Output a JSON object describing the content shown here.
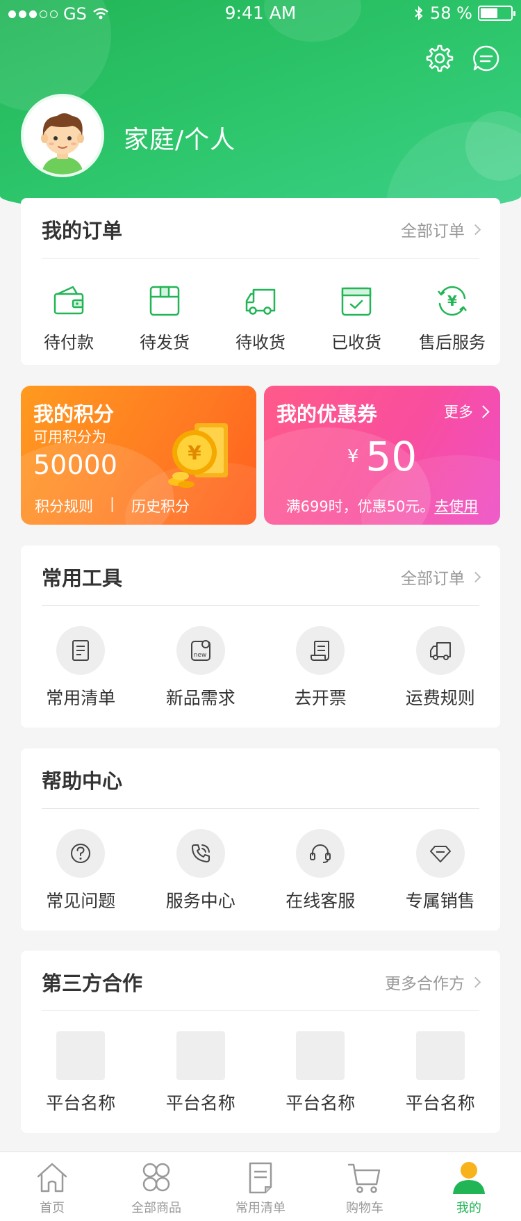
{
  "status_bar": {
    "carrier": "GS",
    "time": "9:41 AM",
    "battery": "58 %"
  },
  "header": {
    "user_name": "家庭/个人",
    "settings_icon": "gear-icon",
    "message_icon": "chat-icon"
  },
  "orders": {
    "title": "我的订单",
    "more": "全部订单",
    "items": [
      {
        "label": "待付款",
        "icon": "wallet-icon"
      },
      {
        "label": "待发货",
        "icon": "package-icon"
      },
      {
        "label": "待收货",
        "icon": "truck-icon"
      },
      {
        "label": "已收货",
        "icon": "received-icon"
      },
      {
        "label": "售后服务",
        "icon": "refund-icon"
      }
    ]
  },
  "points": {
    "title": "我的积分",
    "subtitle": "可用积分为",
    "value": "50000",
    "rules_link": "积分规则",
    "separator": "|",
    "history_link": "历史积分"
  },
  "coupon": {
    "title": "我的优惠券",
    "more": "更多",
    "currency": "¥",
    "amount": "50",
    "rule": "满699时，优惠50元。",
    "use_link": "去使用"
  },
  "tools": {
    "title": "常用工具",
    "more": "全部订单",
    "items": [
      {
        "label": "常用清单",
        "icon": "list-icon"
      },
      {
        "label": "新品需求",
        "icon": "new-product-icon"
      },
      {
        "label": "去开票",
        "icon": "invoice-icon"
      },
      {
        "label": "运费规则",
        "icon": "shipping-icon"
      }
    ]
  },
  "help": {
    "title": "帮助中心",
    "items": [
      {
        "label": "常见问题",
        "icon": "question-icon"
      },
      {
        "label": "服务中心",
        "icon": "phone-icon"
      },
      {
        "label": "在线客服",
        "icon": "headset-icon"
      },
      {
        "label": "专属销售",
        "icon": "diamond-icon"
      }
    ]
  },
  "partners": {
    "title": "第三方合作",
    "more": "更多合作方",
    "items": [
      {
        "label": "平台名称"
      },
      {
        "label": "平台名称"
      },
      {
        "label": "平台名称"
      },
      {
        "label": "平台名称"
      }
    ]
  },
  "tabbar": {
    "items": [
      {
        "label": "首页",
        "icon": "home-icon"
      },
      {
        "label": "全部商品",
        "icon": "categories-icon"
      },
      {
        "label": "常用清单",
        "icon": "list-icon"
      },
      {
        "label": "购物车",
        "icon": "cart-icon"
      },
      {
        "label": "我的",
        "icon": "profile-icon"
      }
    ],
    "active_index": 4
  },
  "colors": {
    "primary": "#22b556",
    "points_orange": "#ff7a22",
    "coupon_pink": "#f94e9e"
  }
}
